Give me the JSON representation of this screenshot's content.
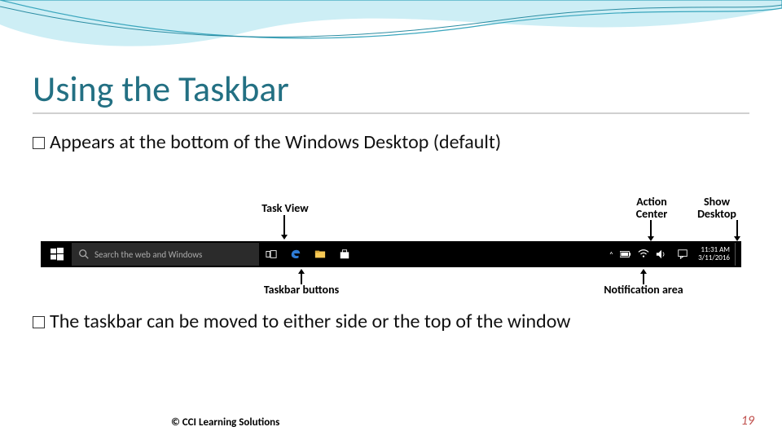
{
  "title": "Using the Taskbar",
  "bullets": {
    "b1": "Appears at the bottom of the Windows Desktop (default)",
    "b2": "The taskbar can be moved to either side or the top of the window"
  },
  "labels": {
    "task_view": "Task View",
    "action_center": "Action\nCenter",
    "show_desktop": "Show\nDesktop",
    "taskbar_buttons": "Taskbar buttons",
    "notification_area": "Notification area"
  },
  "taskbar": {
    "search_placeholder": "Search the web and Windows",
    "clock_time": "11:31 AM",
    "clock_date": "3/11/2016"
  },
  "icons": {
    "start": "windows-logo-icon",
    "search": "search-icon",
    "task_view": "task-view-icon",
    "edge": "edge-icon",
    "explorer": "file-explorer-icon",
    "store": "store-icon",
    "tray_up": "chevron-up-icon",
    "battery": "battery-icon",
    "wifi": "wifi-icon",
    "volume": "volume-icon",
    "action_center": "action-center-icon"
  },
  "footer": {
    "copyright": "© CCI Learning Solutions",
    "page": "19"
  },
  "colors": {
    "title": "#237083",
    "wave1": "#9fd9e6",
    "wave2": "#3aa6bd",
    "page_num": "#c0504d"
  }
}
